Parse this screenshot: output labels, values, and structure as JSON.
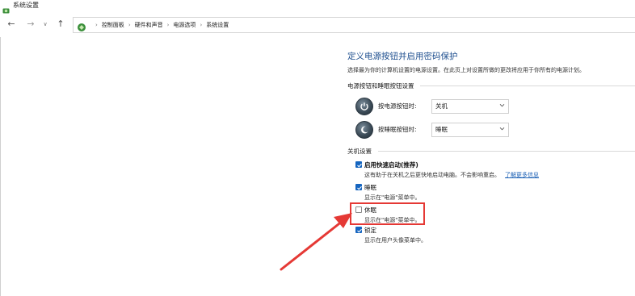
{
  "window": {
    "title": "系统设置"
  },
  "breadcrumb": [
    "控制面板",
    "硬件和声音",
    "电源选项",
    "系统设置"
  ],
  "page": {
    "title": "定义电源按钮并启用密码保护",
    "description": "选择最为你的计算机设置的电源设置。在此页上对设置所做的更改将应用于你所有的电源计划。"
  },
  "power_buttons": {
    "header": "电源按钮和睡眠按钮设置",
    "rows": [
      {
        "label": "按电源按钮时:",
        "value": "关机"
      },
      {
        "label": "按睡眠按钮时:",
        "value": "睡眠"
      }
    ]
  },
  "shutdown": {
    "header": "关机设置",
    "items": [
      {
        "label": "启用快速启动(推荐)",
        "description": "这有助于在关机之后更快地启动电脑。不会影响重启。",
        "link": "了解更多信息",
        "checked": true
      },
      {
        "label": "睡眠",
        "description": "显示在\"电源\"菜单中。",
        "checked": true
      },
      {
        "label": "休眠",
        "description": "显示在\"电源\"菜单中。",
        "checked": false
      },
      {
        "label": "锁定",
        "description": "显示在用户头像菜单中。",
        "checked": true
      }
    ]
  },
  "colors": {
    "accent": "#1565c0",
    "title": "#1e4f8f",
    "highlight": "#e53935"
  }
}
